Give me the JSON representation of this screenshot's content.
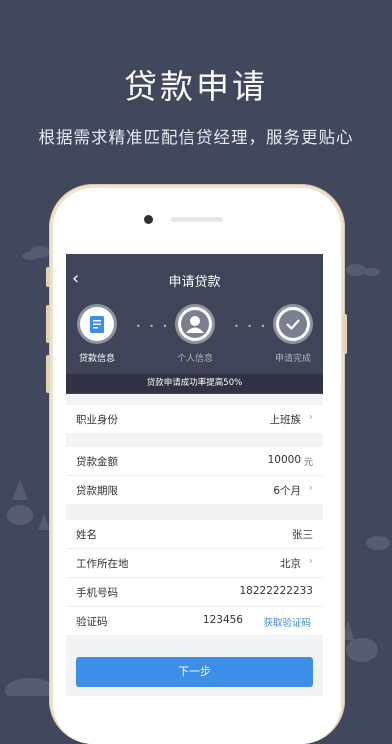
{
  "headline": "贷款申请",
  "subline": "根据需求精准匹配信贷经理，服务更贴心",
  "screen": {
    "title": "申请贷款",
    "steps": [
      {
        "label": "贷款信息",
        "icon": "document-icon",
        "active": true
      },
      {
        "label": "个人信息",
        "icon": "person-icon",
        "active": false
      },
      {
        "label": "申请完成",
        "icon": "check-icon",
        "active": false
      }
    ],
    "banner": "贷款申请成功率提高50%",
    "job": {
      "label": "职业身份",
      "value": "上班族"
    },
    "amount": {
      "label": "贷款金额",
      "value": "10000",
      "unit": "元"
    },
    "term": {
      "label": "贷款期限",
      "value": "6个月"
    },
    "name": {
      "label": "姓名",
      "value": "张三"
    },
    "location": {
      "label": "工作所在地",
      "value": "北京"
    },
    "phone": {
      "label": "手机号码",
      "value": "18222222233"
    },
    "code": {
      "label": "验证码",
      "value": "123456",
      "link": "获取验证码"
    },
    "next_button": "下一步"
  },
  "colors": {
    "background": "#41475d",
    "accent": "#3d8ee8",
    "topbar": "#3f4459"
  }
}
